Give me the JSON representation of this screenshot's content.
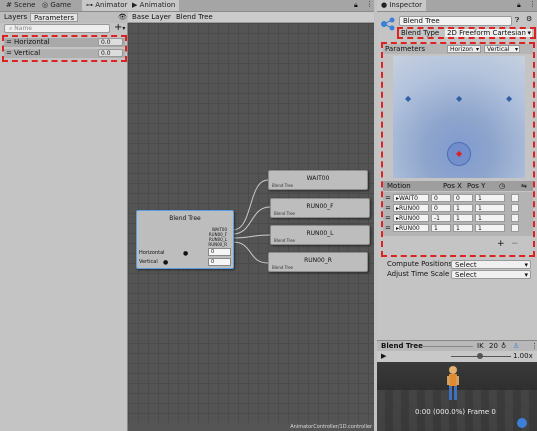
{
  "left_panel": {
    "tabs": [
      "Scene",
      "Game",
      "Animator"
    ],
    "active_tab": "Animator",
    "subtabs": [
      "Layers",
      "Parameters"
    ],
    "search_placeholder": "Name",
    "parameters": [
      {
        "name": "Horizontal",
        "value": "0.0"
      },
      {
        "name": "Vertical",
        "value": "0.0"
      }
    ]
  },
  "animation_panel": {
    "tab": "Animation",
    "breadcrumb": [
      "Base Layer",
      "Blend Tree"
    ],
    "footer": "AnimatorController/1D.controller"
  },
  "blend_tree_node": {
    "title": "Blend Tree",
    "outputs": [
      "WAIT00",
      "RUN00_F",
      "RUN00_L",
      "RUN00_R"
    ],
    "params": [
      {
        "name": "Horizontal",
        "value": "0"
      },
      {
        "name": "Vertical",
        "value": "0"
      }
    ]
  },
  "motion_nodes": [
    {
      "title": "WAIT00",
      "sub": "Blend Tree"
    },
    {
      "title": "RUN00_F",
      "sub": "Blend Tree"
    },
    {
      "title": "RUN00_L",
      "sub": "Blend Tree"
    },
    {
      "title": "RUN00_R",
      "sub": "Blend Tree"
    }
  ],
  "inspector": {
    "tab": "Inspector",
    "name_field": "Blend Tree",
    "blend_type_label": "Blend Type",
    "blend_type_value": "2D Freeform Cartesian",
    "parameters_label": "Parameters",
    "param_x": "Horizon",
    "param_y": "Vertical",
    "motion_headers": [
      "Motion",
      "Pos X",
      "Pos Y"
    ],
    "motions": [
      {
        "name": "WAIT0",
        "x": "0",
        "y": "0",
        "speed": "1"
      },
      {
        "name": "RUN00",
        "x": "0",
        "y": "1",
        "speed": "1"
      },
      {
        "name": "RUN00",
        "x": "-1",
        "y": "1",
        "speed": "1"
      },
      {
        "name": "RUN00",
        "x": "1",
        "y": "1",
        "speed": "1"
      }
    ],
    "compute_positions_label": "Compute Positions",
    "compute_positions_value": "Select",
    "adjust_time_label": "Adjust Time Scale",
    "adjust_time_value": "Select",
    "preview_title": "Blend Tree",
    "preview_ik": "IK",
    "preview_num": "20",
    "preview_speed": "1.00x",
    "preview_time": "0:00 (000.0%) Frame 0"
  },
  "colors": {
    "accent_blue": "#3d7fd6",
    "red_dash": "#dd2222",
    "graph_bg": "#545454",
    "preview_blue": "#8ea5cc"
  }
}
